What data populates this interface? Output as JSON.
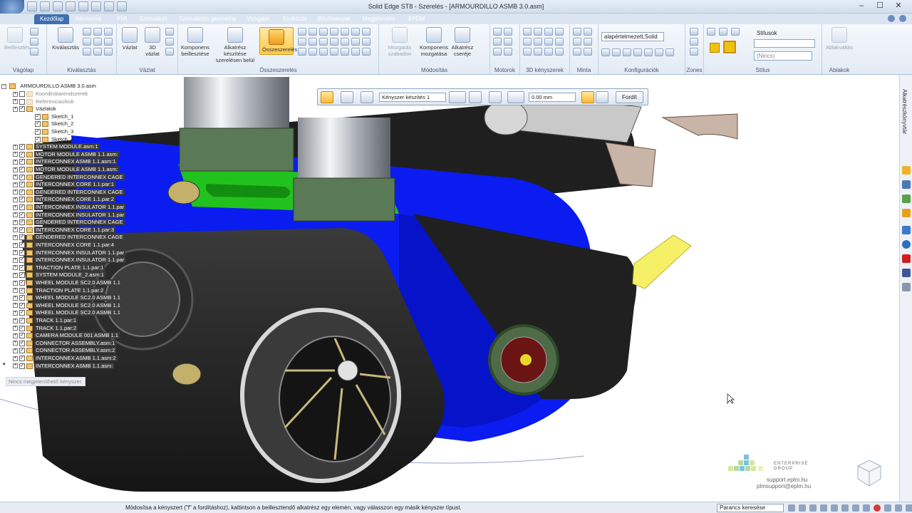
{
  "window": {
    "title": "Solid Edge ST8 - Szerelés - [ARMOURDILLO ASMB 3.0.asm]",
    "controls": [
      "minimize",
      "maximize",
      "close"
    ]
  },
  "tabs": [
    "Kezdőlap",
    "Alkelemek",
    "PMI",
    "Szimuláció",
    "Szimulációs geometria",
    "Vizsgálat",
    "Eszközök",
    "Bővítmények",
    "Megjelenítés",
    "EPDM"
  ],
  "ribbon": {
    "groups": [
      {
        "label": "Vágólap",
        "buttons": [
          "Beillesztés"
        ]
      },
      {
        "label": "Kiválasztás",
        "buttons": [
          "Kiválasztás"
        ]
      },
      {
        "label": "Vázlat",
        "buttons": [
          "Vázlat",
          "3D vázlat"
        ]
      },
      {
        "label": "Összeszerelés",
        "buttons": [
          "Komponens beillesztése",
          "Alkatrész készítése szerelésen belül",
          "Összeszerelés"
        ]
      },
      {
        "label": "Módosítás",
        "buttons": [
          "Mozgatás szabadon",
          "Komponens mozgatása",
          "Alkatrész cseréje"
        ]
      },
      {
        "label": "Motorok",
        "buttons": []
      },
      {
        "label": "3D kényszerek",
        "buttons": []
      },
      {
        "label": "Minta",
        "buttons": []
      },
      {
        "label": "Konfigurációk",
        "buttons": []
      },
      {
        "label": "Zones",
        "buttons": []
      },
      {
        "label": "Stílus",
        "buttons": []
      },
      {
        "label": "Ablakok",
        "buttons": [
          "Ablakváltás"
        ]
      }
    ],
    "config_value": "alapértelmezett,Solid",
    "style_label": "Stílusok",
    "style_value": "(Nincs)"
  },
  "command_bar": {
    "constraint_type": "Kényszer készítés 1",
    "offset_value": "0.00 mm",
    "flip_label": "Fordít"
  },
  "pathfinder": {
    "root": "ARMOURDILLO ASMB 3.0.asm",
    "items": [
      {
        "label": "Koordinátarendszerek",
        "style": "grey",
        "depth": 1
      },
      {
        "label": "Referenciasíkok",
        "style": "grey",
        "depth": 1
      },
      {
        "label": "Vázlatok",
        "style": "plain",
        "depth": 1
      },
      {
        "label": "Sketch_1",
        "style": "plain",
        "depth": 2
      },
      {
        "label": "Sketch_2",
        "style": "plain",
        "depth": 2
      },
      {
        "label": "Sketch_3",
        "style": "plain",
        "depth": 2
      },
      {
        "label": "Sketch_4",
        "style": "plain",
        "depth": 2
      },
      {
        "label": "SYSTEM MODULE.asm:1",
        "style": "dark",
        "depth": 1
      },
      {
        "label": "MOTOR MODULE ASMB 1.1.asm:",
        "style": "dark",
        "depth": 1
      },
      {
        "label": "INTERCONNEX ASMB 1.1.asm:1",
        "style": "dark",
        "depth": 1
      },
      {
        "label": "MOTOR MODULE ASMB 1.1.asm:",
        "style": "dark",
        "depth": 1
      },
      {
        "label": "GENDERED INTERCONNEX CAGE",
        "style": "dark",
        "depth": 1
      },
      {
        "label": "INTERCONNEX CORE 1.1.par:1",
        "style": "dark",
        "depth": 1
      },
      {
        "label": "GENDERED INTERCONNEX CAGE",
        "style": "dark",
        "depth": 1
      },
      {
        "label": "INTERCONNEX CORE 1.1.par:2",
        "style": "dark",
        "depth": 1
      },
      {
        "label": "INTERCONNEX INSULATOR 1.1.par",
        "style": "dark",
        "depth": 1
      },
      {
        "label": "INTERCONNEX INSULATOR 1.1.par",
        "style": "dark",
        "depth": 1
      },
      {
        "label": "GENDERED INTERCONNEX CAGE",
        "style": "dark",
        "depth": 1
      },
      {
        "label": "INTERCONNEX CORE 1.1.par:3",
        "style": "dark",
        "depth": 1
      },
      {
        "label": "GENDERED INTERCONNEX CAGE",
        "style": "dark",
        "depth": 1
      },
      {
        "label": "INTERCONNEX CORE 1.1.par:4",
        "style": "dark",
        "depth": 1
      },
      {
        "label": "INTERCONNEX INSULATOR 1.1.par",
        "style": "dark",
        "depth": 1
      },
      {
        "label": "INTERCONNEX INSULATOR 1.1.par",
        "style": "dark",
        "depth": 1
      },
      {
        "label": "TRACTION PLATE 1.1.par:1",
        "style": "dark",
        "depth": 1
      },
      {
        "label": "SYSTEM MODULE_2.asm:1",
        "style": "dark",
        "depth": 1
      },
      {
        "label": "WHEEL MODULE SC2.0 ASMB 1.1",
        "style": "dark",
        "depth": 1
      },
      {
        "label": "TRACTION PLATE 1.1.par:2",
        "style": "dark",
        "depth": 1
      },
      {
        "label": "WHEEL MODULE SC2.0 ASMB 1.1",
        "style": "dark",
        "depth": 1
      },
      {
        "label": "WHEEL MODULE SC2.0 ASMB 1.1",
        "style": "dark",
        "depth": 1
      },
      {
        "label": "WHEEL MODULE SC2.0 ASMB 1.1",
        "style": "dark",
        "depth": 1
      },
      {
        "label": "TRACK 1.1.par:1",
        "style": "dark",
        "depth": 1
      },
      {
        "label": "TRACK 1.1.par:2",
        "style": "dark",
        "depth": 1
      },
      {
        "label": "CAMERA MODULE 001 ASMB 1.1",
        "style": "dark",
        "depth": 1
      },
      {
        "label": "CONNECTOR ASSEMBLY.asm:1",
        "style": "dark",
        "depth": 1
      },
      {
        "label": "CONNECTOR ASSEMBLY.asm:2",
        "style": "dark",
        "depth": 1
      },
      {
        "label": "INTERCONNEX ASMB 1.1.asm:2",
        "style": "dark",
        "depth": 1
      },
      {
        "label": "INTERCONNEX ASMB 1.1.asm:",
        "style": "dark",
        "depth": 1
      }
    ],
    "status": "Nincs megjeleníthető kényszer."
  },
  "right_panel": {
    "tab_label": "Alkatrészkönyvtár"
  },
  "status_bar": {
    "message": "Módosítsa a kényszert (\"f\" a fordításhoz), kattintson a beillesztendő alkatrész egy elemén, vagy válasszon egy másik kényszer típust.",
    "search_placeholder": "Parancs keresése"
  },
  "branding": {
    "company_line1": "ENTERPRISE",
    "company_line2": "GROUP",
    "email1": "support.eplm.hu",
    "email2": "plmsupport@eplm.hu"
  },
  "colors": {
    "ribbon_tab": "#3f6fb0",
    "highlight": "#ffc94a",
    "assembly_blue": "#0a1cf0",
    "assembly_green": "#22c21e",
    "track": "#2a2a2a"
  }
}
